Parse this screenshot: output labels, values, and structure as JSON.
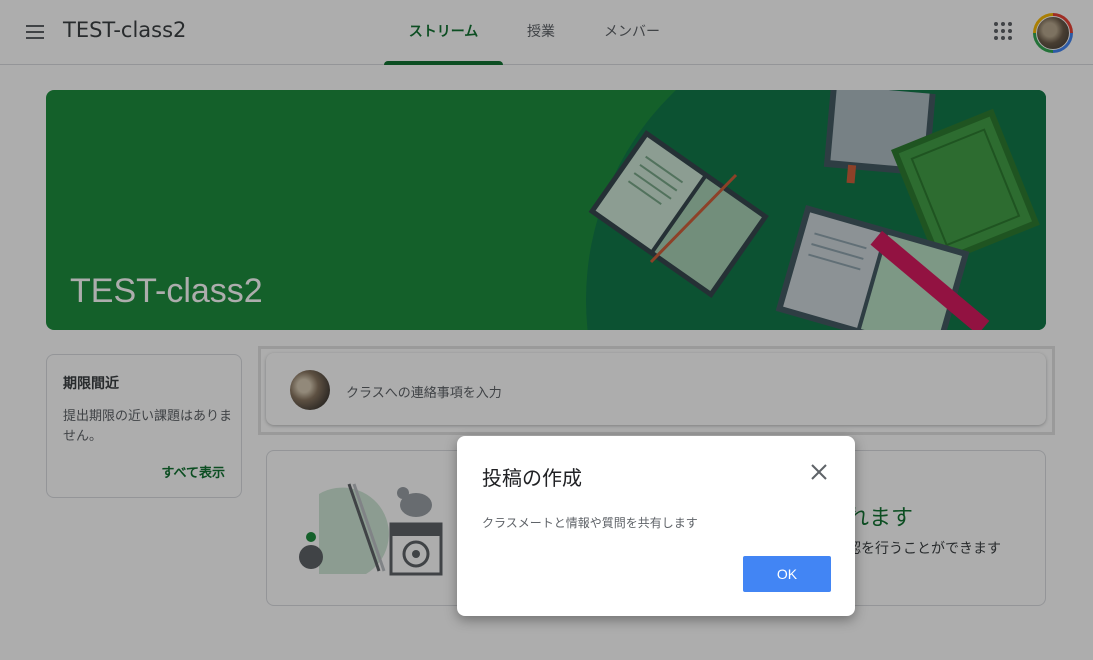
{
  "header": {
    "class_name": "TEST-class2",
    "tabs": [
      {
        "label": "ストリーム",
        "active": true
      },
      {
        "label": "授業",
        "active": false
      },
      {
        "label": "メンバー",
        "active": false
      }
    ]
  },
  "banner": {
    "title": "TEST-class2"
  },
  "upcoming": {
    "title": "期限間近",
    "text": "提出期限の近い課題はありません。",
    "view_all": "すべて表示"
  },
  "announce": {
    "placeholder": "クラスへの連絡事項を入力"
  },
  "stream_card": {
    "heading_partial": "れます",
    "sub_partial": "認を行うことができます"
  },
  "dialog": {
    "title": "投稿の作成",
    "body": "クラスメートと情報や質問を共有します",
    "ok": "OK"
  },
  "colors": {
    "accent_green": "#137333",
    "banner_green": "#1e8e3e",
    "button_blue": "#4285f4"
  }
}
